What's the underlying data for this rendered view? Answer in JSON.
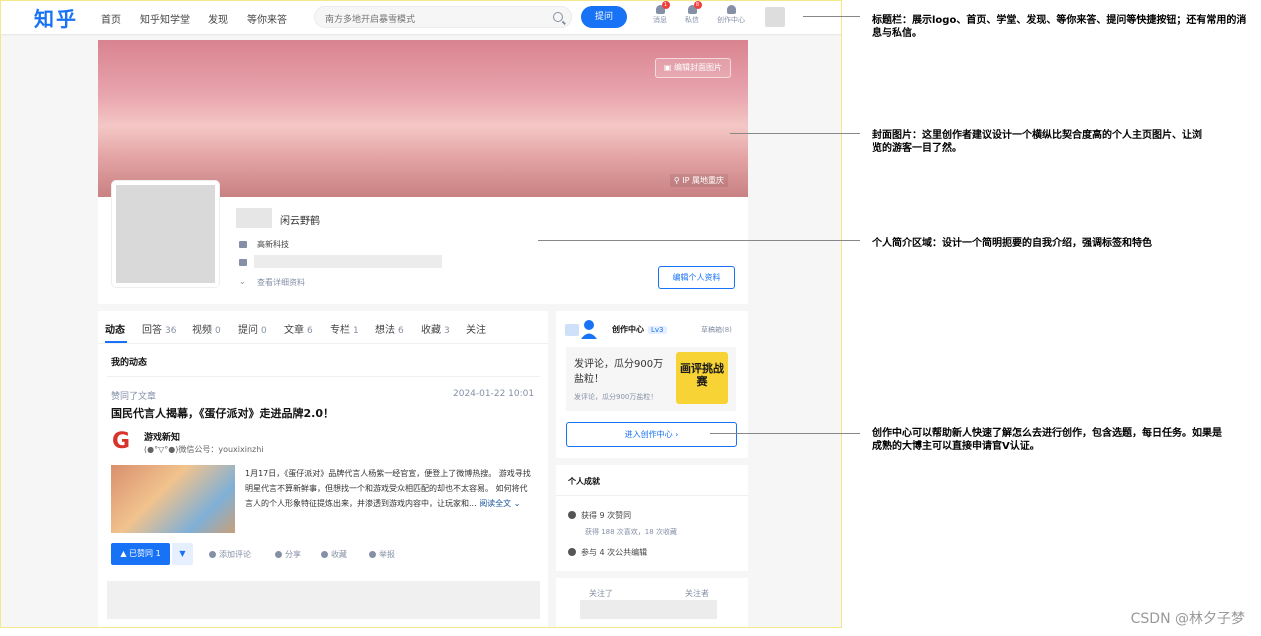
{
  "topbar": {
    "logo": "知乎",
    "nav": [
      "首页",
      "知乎知学堂",
      "发现",
      "等你来答"
    ],
    "search_placeholder": "南方多地开启暴雪模式",
    "ask_label": "提问",
    "icons": [
      {
        "label": "消息",
        "badge": "1",
        "icon": "bell-icon"
      },
      {
        "label": "私信",
        "badge": "8",
        "icon": "chat-icon"
      },
      {
        "label": "创作中心",
        "badge": "",
        "icon": "creator-icon"
      }
    ]
  },
  "cover": {
    "edit_label": "编辑封面图片",
    "ip_label": "IP 属地重庆"
  },
  "profile": {
    "name": "闲云野鹤",
    "industry": "高新科技",
    "detail_link": "查看详细资料",
    "edit_button": "编辑个人资料"
  },
  "tabs": [
    {
      "label": "动态",
      "count": ""
    },
    {
      "label": "回答",
      "count": "36"
    },
    {
      "label": "视频",
      "count": "0"
    },
    {
      "label": "提问",
      "count": "0"
    },
    {
      "label": "文章",
      "count": "6"
    },
    {
      "label": "专栏",
      "count": "1"
    },
    {
      "label": "想法",
      "count": "6"
    },
    {
      "label": "收藏",
      "count": "3"
    },
    {
      "label": "关注",
      "count": ""
    }
  ],
  "feed": {
    "section_title": "我的动态",
    "action": "赞同了文章",
    "time": "2024-01-22 10:01",
    "headline": "国民代言人揭幕，《蛋仔派对》走进品牌2.0！",
    "author_name": "游戏新知",
    "author_desc": "(●°▽°●)微信公号：youxixinzhi",
    "excerpt": "1月17日，《蛋仔派对》品牌代言人杨紫一经官宣，便登上了微博热搜。 游戏寻找明星代言不算新鲜事，但想找一个和游戏受众相匹配的却也不太容易。 如何将代言人的个人形象特征提炼出来，并渗透到游戏内容中，让玩家和...",
    "read_more": "阅读全文",
    "vote_label": "▲ 已赞同 1",
    "vote_down": "▼",
    "actions": [
      "添加评论",
      "分享",
      "收藏",
      "举报"
    ]
  },
  "creator": {
    "title": "创作中心",
    "level": "Lv3",
    "drafts": "草稿箱(8)",
    "promo_title": "发评论，瓜分900万盐粒！",
    "promo_sub": "发评论，瓜分900万盐粒！",
    "promo_image_text": "画评挑战赛",
    "enter_label": "进入创作中心 ›"
  },
  "achievements": {
    "title": "个人成就",
    "likes": "获得 9 次赞同",
    "likes_sub": "获得 188 次喜欢，18 次收藏",
    "edits": "参与 4 次公共编辑"
  },
  "follow": {
    "following": "关注了",
    "followers": "关注者"
  },
  "annotations": [
    "标题栏：展示logo、首页、学堂、发现、等你来答、提问等快捷按钮；还有常用的消息与私信。",
    "封面图片：这里创作者建议设计一个横纵比契合度高的个人主页图片、让浏览的游客一目了然。",
    "个人简介区域：设计一个简明扼要的自我介绍，强调标签和特色",
    "创作中心可以帮助新人快速了解怎么去进行创作，包含选题，每日任务。如果是成熟的大博主可以直接申请官V认证。"
  ],
  "watermark": "CSDN @林夕子梦"
}
